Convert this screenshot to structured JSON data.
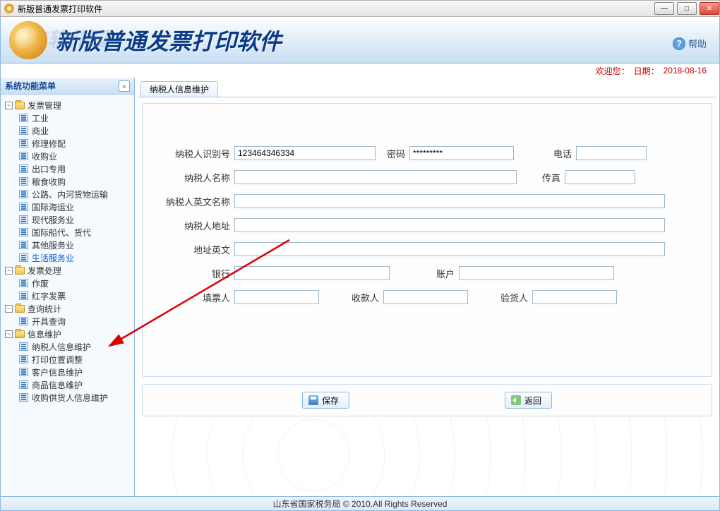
{
  "window": {
    "title": "新版普通发票打印软件"
  },
  "header": {
    "title": "新版普通发票打印软件",
    "watermark": "河东软件园",
    "help": "帮助"
  },
  "welcome": {
    "greet": "欢迎您：",
    "datelabel": "日期：",
    "date": "2018-08-16"
  },
  "sidebar": {
    "title": "系统功能菜单",
    "groups": [
      {
        "label": "发票管理",
        "children": [
          {
            "label": "工业"
          },
          {
            "label": "商业"
          },
          {
            "label": "修理修配"
          },
          {
            "label": "收购业"
          },
          {
            "label": "出口专用"
          },
          {
            "label": "粮食收购"
          },
          {
            "label": "公路、内河货物运输"
          },
          {
            "label": "国际海运业"
          },
          {
            "label": "现代服务业"
          },
          {
            "label": "国际船代、货代"
          },
          {
            "label": "其他服务业"
          },
          {
            "label": "生活服务业",
            "selected": true
          }
        ]
      },
      {
        "label": "发票处理",
        "children": [
          {
            "label": "作废"
          },
          {
            "label": "红字发票"
          }
        ]
      },
      {
        "label": "查询统计",
        "children": [
          {
            "label": "开具查询"
          }
        ]
      },
      {
        "label": "信息维护",
        "children": [
          {
            "label": "纳税人信息维护"
          },
          {
            "label": "打印位置调整"
          },
          {
            "label": "客户信息维护"
          },
          {
            "label": "商品信息维护"
          },
          {
            "label": "收购供货人信息维护"
          }
        ]
      }
    ]
  },
  "tab": {
    "label": "纳税人信息维护"
  },
  "form": {
    "taxid_label": "纳税人识别号",
    "taxid_value": "123464346334",
    "pwd_label": "密码",
    "pwd_value": "*********",
    "tel_label": "电话",
    "tel_value": "",
    "name_label": "纳税人名称",
    "name_value": "",
    "fax_label": "传真",
    "fax_value": "",
    "enname_label": "纳税人英文名称",
    "enname_value": "",
    "addr_label": "纳税人地址",
    "addr_value": "",
    "enaddr_label": "地址英文",
    "enaddr_value": "",
    "bank_label": "银行",
    "bank_value": "",
    "acct_label": "账户",
    "acct_value": "",
    "filler_label": "填票人",
    "filler_value": "",
    "payee_label": "收款人",
    "payee_value": "",
    "checker_label": "验货人",
    "checker_value": ""
  },
  "buttons": {
    "save": "保存",
    "back": "返回"
  },
  "footer": {
    "text": "山东省国家税务局 © 2010.All Rights Reserved"
  }
}
